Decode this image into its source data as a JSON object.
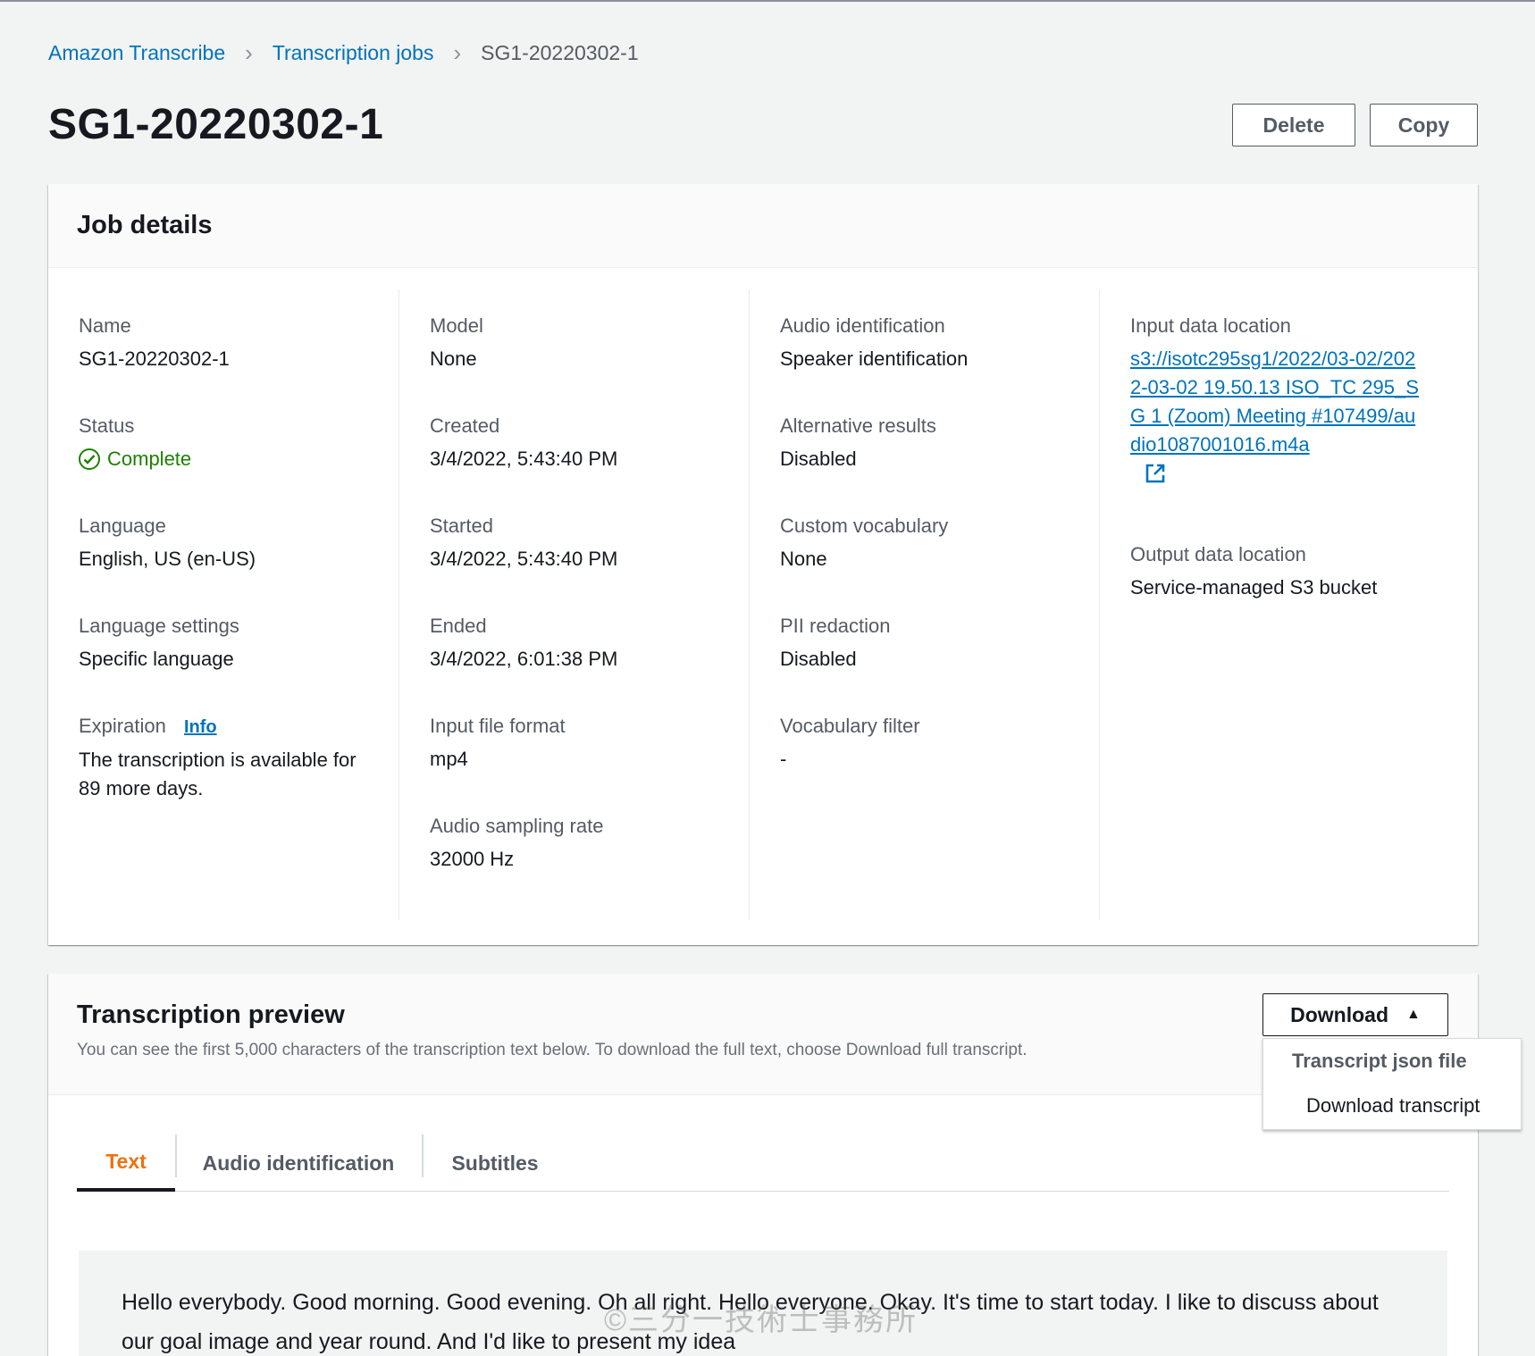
{
  "breadcrumb": {
    "items": [
      "Amazon Transcribe",
      "Transcription jobs"
    ],
    "current": "SG1-20220302-1"
  },
  "page": {
    "title": "SG1-20220302-1",
    "delete_label": "Delete",
    "copy_label": "Copy"
  },
  "job_details": {
    "title": "Job details",
    "columns": [
      [
        {
          "label": "Name",
          "value": "SG1-20220302-1"
        },
        {
          "label": "Status",
          "value": "Complete"
        },
        {
          "label": "Language",
          "value": "English, US (en-US)"
        },
        {
          "label": "Language settings",
          "value": "Specific language"
        },
        {
          "label": "Expiration",
          "info": "Info",
          "value": "The transcription is available for 89 more days."
        }
      ],
      [
        {
          "label": "Model",
          "value": "None"
        },
        {
          "label": "Created",
          "value": "3/4/2022, 5:43:40 PM"
        },
        {
          "label": "Started",
          "value": "3/4/2022, 5:43:40 PM"
        },
        {
          "label": "Ended",
          "value": "3/4/2022, 6:01:38 PM"
        },
        {
          "label": "Input file format",
          "value": "mp4"
        },
        {
          "label": "Audio sampling rate",
          "value": "32000 Hz"
        }
      ],
      [
        {
          "label": "Audio identification",
          "value": "Speaker identification"
        },
        {
          "label": "Alternative results",
          "value": "Disabled"
        },
        {
          "label": "Custom vocabulary",
          "value": "None"
        },
        {
          "label": "PII redaction",
          "value": "Disabled"
        },
        {
          "label": "Vocabulary filter",
          "value": "-"
        }
      ],
      [
        {
          "label": "Input data location",
          "value": "s3://isotc295sg1/2022/03-02/2022-03-02 19.50.13 ISO_TC 295_SG 1 (Zoom) Meeting #107499/audio1087001016.m4a"
        },
        {
          "label": "Output data location",
          "value": "Service-managed S3 bucket"
        }
      ]
    ]
  },
  "preview": {
    "title": "Transcription preview",
    "description": "You can see the first 5,000 characters of the transcription text below. To download the full text, choose Download full transcript.",
    "download_label": "Download",
    "tabs": [
      "Text",
      "Audio identification",
      "Subtitles"
    ],
    "transcript": "Hello everybody. Good morning. Good evening. Oh all right. Hello everyone. Okay. It's time to start today. I like to discuss about our goal image and year round. And I'd like to present my idea"
  },
  "dropdown": {
    "group_label": "Transcript json file",
    "option_label": "Download transcript"
  },
  "watermark": "©三分一技術士事務所",
  "colors": {
    "link": "#0073bb",
    "success": "#1d8102",
    "active_tab": "#ec7211"
  }
}
